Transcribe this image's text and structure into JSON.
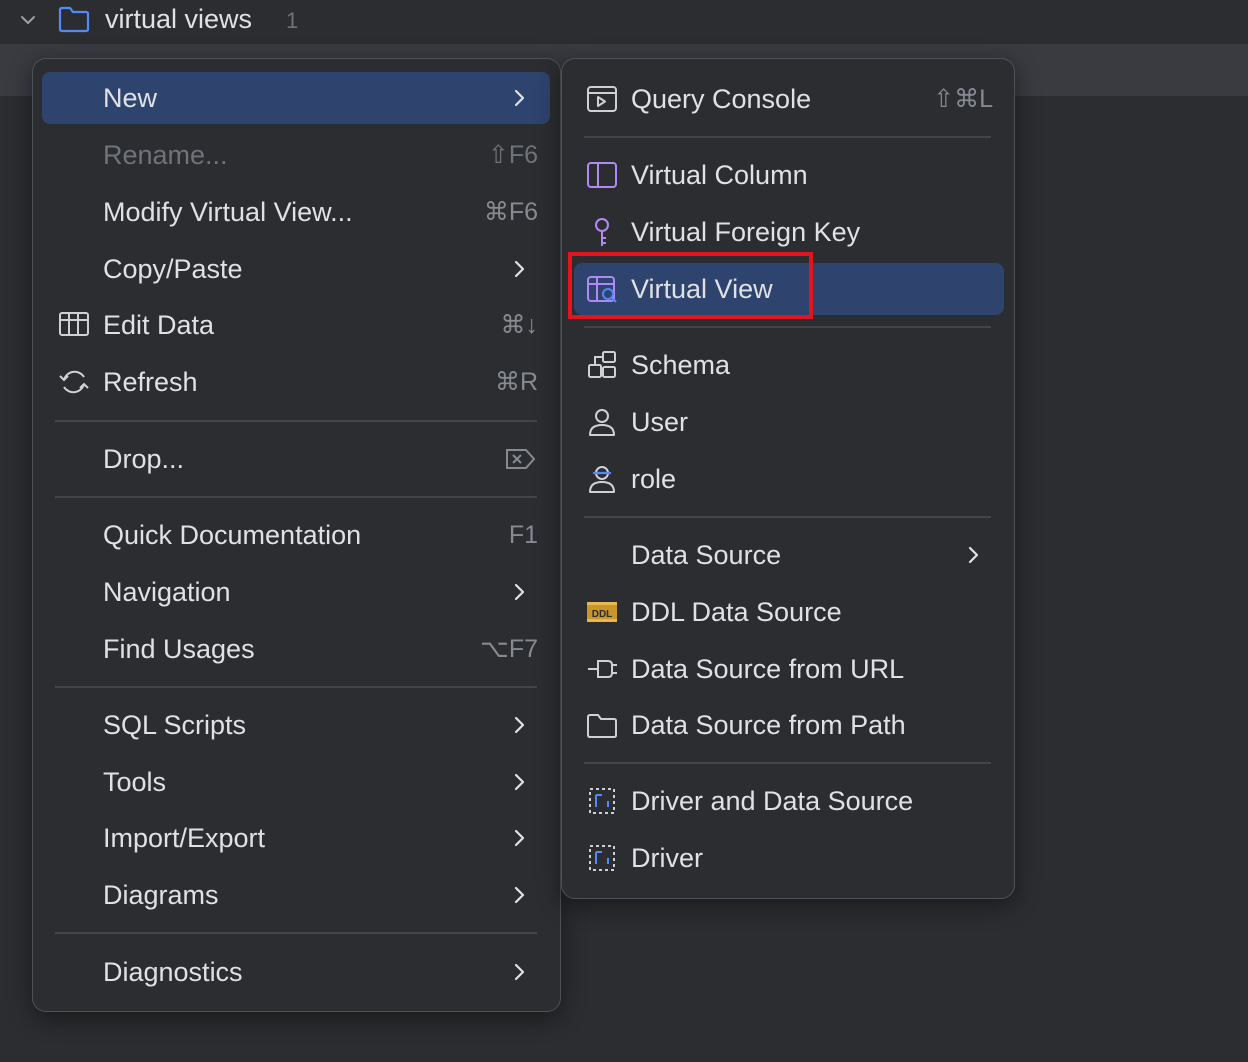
{
  "tree": {
    "folder_label": "virtual views",
    "folder_count": "1"
  },
  "context_menu": {
    "items": [
      {
        "label": "New",
        "shortcut": ""
      },
      {
        "label": "Rename...",
        "shortcut": "⇧F6"
      },
      {
        "label": "Modify Virtual View...",
        "shortcut": "⌘F6"
      },
      {
        "label": "Copy/Paste",
        "shortcut": ""
      },
      {
        "label": "Edit Data",
        "shortcut": "⌘↓"
      },
      {
        "label": "Refresh",
        "shortcut": "⌘R"
      },
      {
        "label": "Drop...",
        "shortcut": ""
      },
      {
        "label": "Quick Documentation",
        "shortcut": "F1"
      },
      {
        "label": "Navigation",
        "shortcut": ""
      },
      {
        "label": "Find Usages",
        "shortcut": "⌥F7"
      },
      {
        "label": "SQL Scripts",
        "shortcut": ""
      },
      {
        "label": "Tools",
        "shortcut": ""
      },
      {
        "label": "Import/Export",
        "shortcut": ""
      },
      {
        "label": "Diagrams",
        "shortcut": ""
      },
      {
        "label": "Diagnostics",
        "shortcut": ""
      }
    ]
  },
  "new_submenu": {
    "items": [
      {
        "label": "Query Console",
        "shortcut": "⇧⌘L"
      },
      {
        "label": "Virtual Column"
      },
      {
        "label": "Virtual Foreign Key"
      },
      {
        "label": "Virtual View"
      },
      {
        "label": "Schema"
      },
      {
        "label": "User"
      },
      {
        "label": "role"
      },
      {
        "label": "Data Source"
      },
      {
        "label": "DDL Data Source"
      },
      {
        "label": "Data Source from URL"
      },
      {
        "label": "Data Source from Path"
      },
      {
        "label": "Driver and Data Source"
      },
      {
        "label": "Driver"
      }
    ]
  },
  "colors": {
    "background": "#2b2d30",
    "active_item": "#2e436e",
    "highlight_box": "#e5141c",
    "text": "#dfe1e5",
    "muted_text": "#6f737a"
  }
}
